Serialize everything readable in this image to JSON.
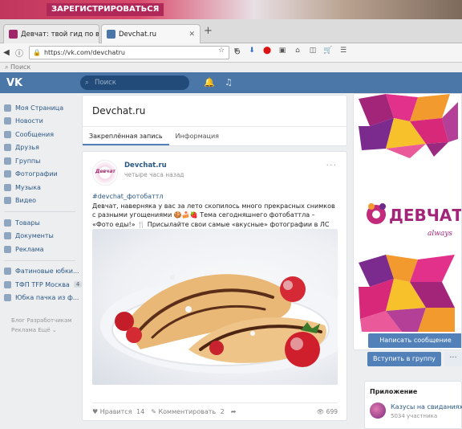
{
  "banner": {
    "cta_label": "ЗАРЕГИСТРИРОВАТЬСЯ"
  },
  "browser": {
    "tabs": [
      {
        "title": "Девчат: твой гид по взросл",
        "favicon_color": "#a0286a",
        "active": false
      },
      {
        "title": "Devchat.ru",
        "favicon_color": "#4a76a8",
        "active": true
      }
    ],
    "new_tab_label": "+",
    "url": "https://vk.com/devchatru",
    "find_placeholder": "Поиск"
  },
  "vk_header": {
    "logo": "VK",
    "search_placeholder": "Поиск"
  },
  "left_menu": {
    "items": [
      {
        "label": "Моя Страница",
        "icon": "user-icon"
      },
      {
        "label": "Новости",
        "icon": "news-icon"
      },
      {
        "label": "Сообщения",
        "icon": "messages-icon"
      },
      {
        "label": "Друзья",
        "icon": "friends-icon"
      },
      {
        "label": "Группы",
        "icon": "groups-icon"
      },
      {
        "label": "Фотографии",
        "icon": "photos-icon"
      },
      {
        "label": "Музыка",
        "icon": "music-icon"
      },
      {
        "label": "Видео",
        "icon": "video-icon"
      }
    ],
    "items2": [
      {
        "label": "Товары",
        "icon": "goods-icon"
      },
      {
        "label": "Документы",
        "icon": "documents-icon"
      },
      {
        "label": "Реклама",
        "icon": "ads-icon"
      }
    ],
    "items3": [
      {
        "label": "Фатиновые юбки...",
        "count": ""
      },
      {
        "label": "ТФП TFP Москва",
        "count": "4"
      },
      {
        "label": "Юбка пачка из ф...",
        "count": ""
      }
    ],
    "footer_line1": "Блог   Разработчикам",
    "footer_line2": "Реклама   Ещё ⌄"
  },
  "group": {
    "title": "Devchat.ru",
    "tabs": [
      "Закреплённая запись",
      "Информация"
    ]
  },
  "post": {
    "author": "Devchat.ru",
    "time": "четыре часа назад",
    "avatar_text": "Девчат",
    "hashtag": "#devchat_фотобаттл",
    "text": "Девчат, наверняка у вас за лето скопилось много прекрасных снимков с разными угощениями 🍪🍰🍓 Тема сегодняшнего фотобаттла – «Фото еды!» 🍴 Присылайте свои самые «вкусные» фотографии в ЛС группы! Удачи! :)",
    "like_label": "Нравится",
    "like_count": "14",
    "comment_label": "Комментировать",
    "comment_count": "2",
    "views": "699"
  },
  "right": {
    "brand": "ДЕВЧАТ",
    "brand_sub": "always",
    "send_message": "Написать сообщение",
    "join": "Вступить в группу",
    "more": "···",
    "app_title": "Приложение",
    "app_name": "Казусы на свиданиях",
    "app_members": "5034 участника"
  },
  "colors": {
    "vk_blue": "#4a76a8",
    "button_blue": "#5181b8",
    "link": "#2a5885",
    "brand_magenta": "#a02a6c"
  }
}
